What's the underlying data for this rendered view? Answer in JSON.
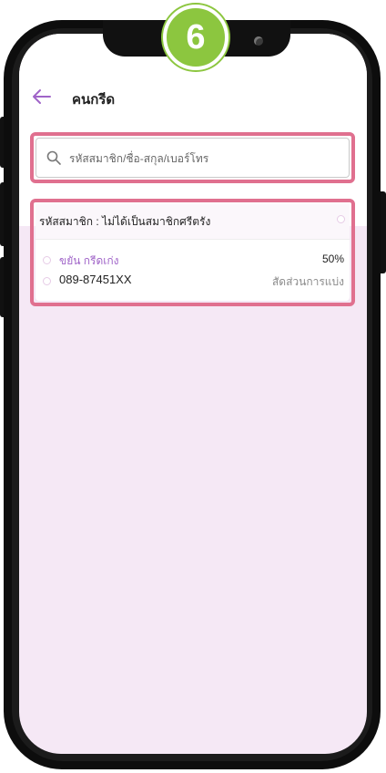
{
  "tutorial": {
    "step_number": "6"
  },
  "header": {
    "title": "คนกรีด"
  },
  "search": {
    "placeholder": "รหัสสมาชิก/ชื่อ-สกุล/เบอร์โทร"
  },
  "result": {
    "member_line": "รหัสสมาชิก : ไม่ได้เป็นสมาชิกศรีตรัง",
    "name": "ขยัน กรีดเก่ง",
    "phone": "089-87451XX",
    "share_percent": "50%",
    "share_label": "สัดส่วนการแบ่ง"
  },
  "colors": {
    "accent": "#a064c8",
    "highlight": "#e0708f",
    "badge": "#8cc63f",
    "screen_bg": "#f5e8f5"
  },
  "icons": [
    "back-arrow-icon",
    "search-icon",
    "camera-icon"
  ]
}
